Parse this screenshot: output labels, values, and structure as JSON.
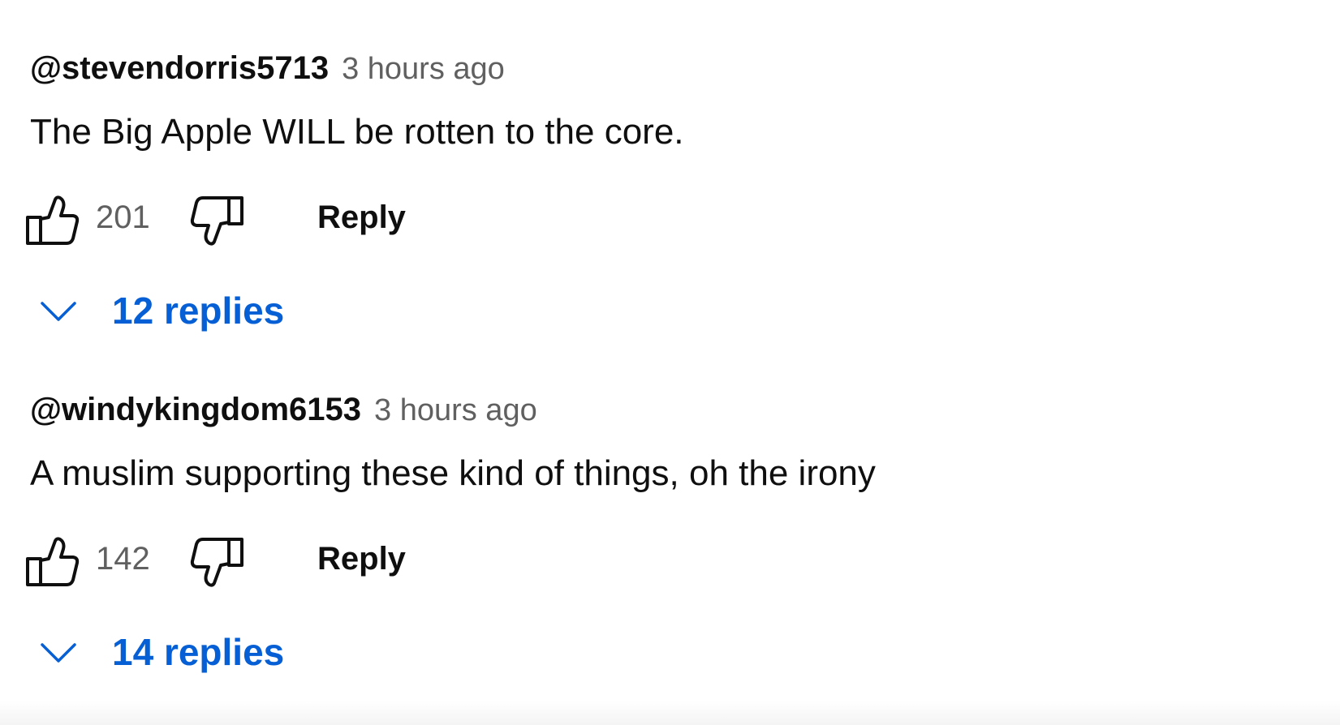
{
  "comments": [
    {
      "author": "@stevendorris5713",
      "time": "3 hours ago",
      "text": "The Big Apple WILL be rotten to the core.",
      "likes": "201",
      "reply_label": "Reply",
      "replies_label": "12 replies"
    },
    {
      "author": "@windykingdom6153",
      "time": "3 hours ago",
      "text": "A muslim supporting these kind of things, oh the irony",
      "likes": "142",
      "reply_label": "Reply",
      "replies_label": "14 replies"
    }
  ],
  "icons": {
    "like": "thumbs-up-icon",
    "dislike": "thumbs-down-icon",
    "expand": "chevron-down-icon"
  },
  "colors": {
    "author": "#0f0f0f",
    "meta": "#606060",
    "link": "#065fd4"
  }
}
